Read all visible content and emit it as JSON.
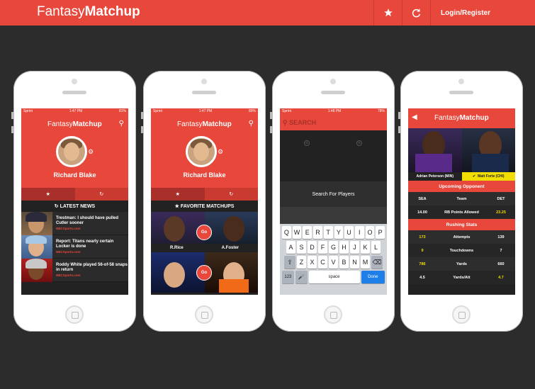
{
  "header": {
    "brand_light": "Fantasy",
    "brand_bold": "Matchup",
    "login_label": "Login/Register",
    "icons": [
      "star-icon",
      "refresh-icon"
    ]
  },
  "phones": [
    {
      "status": {
        "carrier": "Sprint",
        "time": "1:47 PM",
        "battery": "81%"
      },
      "app_title_light": "Fantasy",
      "app_title_bold": "Matchup",
      "user_name": "Richard Blake",
      "section_title": "LATEST NEWS",
      "news": [
        {
          "title": "Trestman: I should have pulled Cutler sooner",
          "source": "NBCSports.com"
        },
        {
          "title": "Report: Titans nearly certain Locker is done",
          "source": "NBCSports.com"
        },
        {
          "title": "Roddy White played 56-of-58 snaps in return",
          "source": "NBCSports.com"
        }
      ]
    },
    {
      "status": {
        "carrier": "Sprint",
        "time": "1:47 PM",
        "battery": "80%"
      },
      "app_title_light": "Fantasy",
      "app_title_bold": "Matchup",
      "user_name": "Richard Blake",
      "section_title": "FAVORITE MATCHUPS",
      "matchups": [
        {
          "left": "R.Rice",
          "right": "A.Foster",
          "go": "Go"
        },
        {
          "left": "",
          "right": "",
          "go": "Go"
        }
      ]
    },
    {
      "status": {
        "carrier": "Sprint",
        "time": "1:48 PM",
        "battery": "78%"
      },
      "search_placeholder": "SEARCH",
      "search_for_players": "Search For Players",
      "keyboard": {
        "row1": [
          "Q",
          "W",
          "E",
          "R",
          "T",
          "Y",
          "U",
          "I",
          "O",
          "P"
        ],
        "row2": [
          "A",
          "S",
          "D",
          "F",
          "G",
          "H",
          "J",
          "K",
          "L"
        ],
        "row3": [
          "Z",
          "X",
          "C",
          "V",
          "B",
          "N",
          "M"
        ],
        "numbers": "123",
        "space": "space",
        "done": "Done"
      }
    },
    {
      "app_title_light": "Fantasy",
      "app_title_bold": "Matchup",
      "player_left": "Adrian Peterson (MIN)",
      "player_right": "Matt Forte (CHI)",
      "upcoming_title": "Upcoming Opponent",
      "upcoming_header": [
        "SEA",
        "Team",
        "DET"
      ],
      "upcoming_row": [
        "14.00",
        "RB Points Allowed",
        "23.25"
      ],
      "rushing_title": "Rushing Stats",
      "rushing": [
        [
          "173",
          "Attempts",
          "139"
        ],
        [
          "9",
          "Touchdowns",
          "7"
        ],
        [
          "786",
          "Yards",
          "660"
        ],
        [
          "4.5",
          "Yards/Att",
          "4.7"
        ]
      ]
    }
  ]
}
